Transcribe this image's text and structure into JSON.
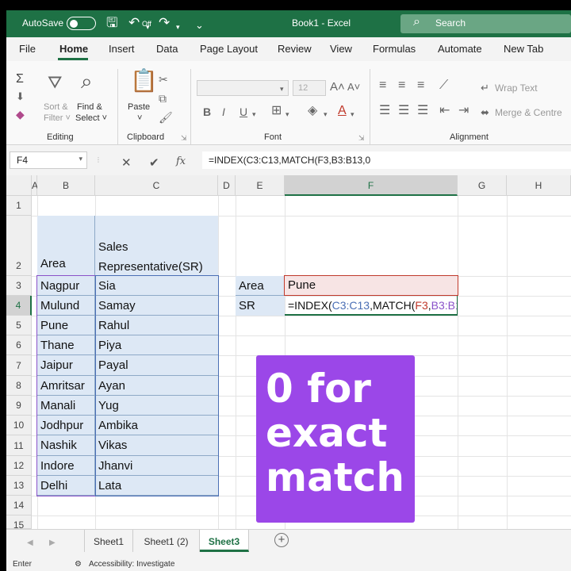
{
  "titlebar": {
    "autosave_label": "AutoSave",
    "autosave_state": "Off",
    "document_title": "Book1 - Excel",
    "search_placeholder": "Search"
  },
  "menu": {
    "tabs": [
      "File",
      "Home",
      "Insert",
      "Data",
      "Page Layout",
      "Review",
      "View",
      "Formulas",
      "Automate",
      "New Tab"
    ],
    "active": "Home"
  },
  "ribbon": {
    "editing": {
      "sort_filter": "Sort &",
      "sort_filter2": "Filter ˅",
      "find_select": "Find &",
      "find_select2": "Select ˅",
      "label": "Editing"
    },
    "clipboard": {
      "paste": "Paste",
      "paste_arrow": "˅",
      "label": "Clipboard"
    },
    "font": {
      "size": "12",
      "bold": "B",
      "italic": "I",
      "underline": "U",
      "label": "Font"
    },
    "alignment": {
      "wrap": "Wrap Text",
      "merge": "Merge & Centre",
      "label": "Alignment"
    }
  },
  "formula_bar": {
    "name_box": "F4",
    "cancel": "✕",
    "enter": "✔",
    "fx": "fx",
    "formula": "=INDEX(C3:C13,MATCH(F3,B3:B13,0"
  },
  "columns": [
    "A",
    "B",
    "C",
    "D",
    "E",
    "F",
    "G",
    "H"
  ],
  "rows": [
    "1",
    "2",
    "3",
    "4",
    "5",
    "6",
    "7",
    "8",
    "9",
    "10",
    "11",
    "12",
    "13",
    "14",
    "15"
  ],
  "table": {
    "header_area": "Area",
    "header_sr_line1": "Sales",
    "header_sr_line2": "Representative(SR)",
    "rows": [
      {
        "area": "Nagpur",
        "sr": "Sia"
      },
      {
        "area": "Mulund",
        "sr": "Samay"
      },
      {
        "area": "Pune",
        "sr": "Rahul"
      },
      {
        "area": "Thane",
        "sr": "Piya"
      },
      {
        "area": "Jaipur",
        "sr": "Payal"
      },
      {
        "area": "Amritsar",
        "sr": "Ayan"
      },
      {
        "area": "Manali",
        "sr": "Yug"
      },
      {
        "area": "Jodhpur",
        "sr": "Ambika"
      },
      {
        "area": "Nashik",
        "sr": "Vikas"
      },
      {
        "area": "Indore",
        "sr": "Jhanvi"
      },
      {
        "area": "Delhi",
        "sr": "Lata"
      }
    ]
  },
  "lookup": {
    "area_label": "Area",
    "area_value": "Pune",
    "sr_label": "SR",
    "formula_parts": {
      "p1": "=INDEX(",
      "p2": "C3:C13",
      "p3": ",MATCH(",
      "p4": "F3",
      "p5": ",",
      "p6": "B3:B13",
      "p7": ",0"
    }
  },
  "callout": {
    "line1": "0 for",
    "line2": "exact",
    "line3": "match"
  },
  "sheets": {
    "tabs": [
      "Sheet1",
      "Sheet1 (2)",
      "Sheet3"
    ],
    "active": "Sheet3",
    "add": "+"
  },
  "status": {
    "mode": "Enter",
    "accessibility": "Accessibility: Investigate"
  },
  "colors": {
    "accent": "#1e7145",
    "callout": "#9b47e8",
    "table_fill": "#dde8f5"
  }
}
